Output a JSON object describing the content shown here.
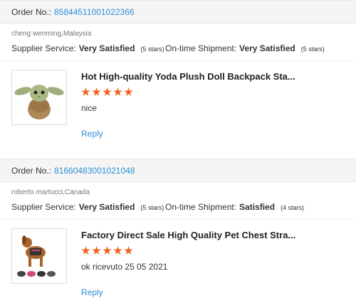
{
  "reviews": [
    {
      "order_label": "Order No.:",
      "order_number": "85844511001022366",
      "buyer": "cheng wenming,Malaysia",
      "supplier_label": "Supplier Service:",
      "supplier_value": "Very Satisfied",
      "supplier_stars": "(5 stars)",
      "shipment_label": "On-time Shipment:",
      "shipment_value": "Very Satisfied",
      "shipment_stars": "(5 stars)",
      "product_title": "Hot High-quality Yoda Plush Doll Backpack Sta...",
      "rating": 5,
      "comment": "nice",
      "reply_label": "Reply",
      "thumb_icon": "yoda-plush-icon"
    },
    {
      "order_label": "Order No.:",
      "order_number": "81660483001021048",
      "buyer": "roberto martucci,Canada",
      "supplier_label": "Supplier Service:",
      "supplier_value": "Very Satisfied",
      "supplier_stars": "(5 stars)",
      "shipment_label": "On-time Shipment:",
      "shipment_value": "Satisfied",
      "shipment_stars": "(4 stars)",
      "product_title": "Factory Direct Sale High Quality Pet Chest Stra...",
      "rating": 5,
      "comment": "ok ricevuto 25 05 2021",
      "reply_label": "Reply",
      "thumb_icon": "dog-harness-icon"
    }
  ],
  "colors": {
    "link": "#2e8fd6",
    "star": "#f25f21",
    "bar": "#f5f5f5"
  }
}
